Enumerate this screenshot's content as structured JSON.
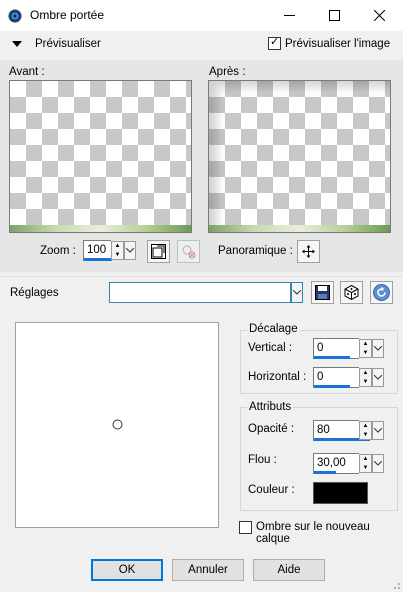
{
  "window": {
    "title": "Ombre portée",
    "icon": "psp-app-icon"
  },
  "preview_section": {
    "label": "Prévisualiser",
    "preview_image_label": "Prévisualiser l'image",
    "preview_image_checked": true
  },
  "panes": {
    "before_label": "Avant :",
    "after_label": "Après :"
  },
  "zoom": {
    "label": "Zoom :",
    "value": "100",
    "pan_label": "Panoramique :"
  },
  "settings": {
    "label": "Réglages",
    "value": ""
  },
  "offset": {
    "group_label": "Décalage",
    "vertical_label": "Vertical :",
    "vertical_value": "0",
    "horizontal_label": "Horizontal :",
    "horizontal_value": "0"
  },
  "attributes": {
    "group_label": "Attributs",
    "opacity_label": "Opacité :",
    "opacity_value": "80",
    "blur_label": "Flou :",
    "blur_value": "30,00",
    "color_label": "Couleur :",
    "color_value": "#000000"
  },
  "shadow_new_layer": {
    "label": "Ombre sur le nouveau calque",
    "checked": false
  },
  "buttons": {
    "ok": "OK",
    "cancel": "Annuler",
    "help": "Aide"
  },
  "colors": {
    "accent": "#1a73d8",
    "default_button_border": "#0078d7"
  }
}
